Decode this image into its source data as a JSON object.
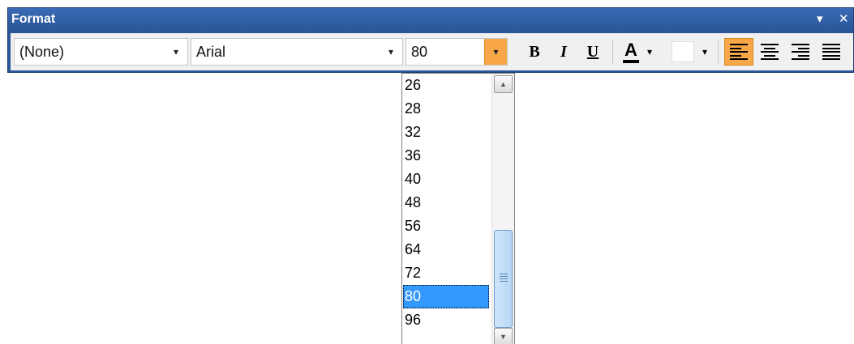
{
  "panel": {
    "title": "Format",
    "menu_glyph": "▾",
    "close_glyph": "✕"
  },
  "toolbar": {
    "style_select": {
      "value": "(None)",
      "arrow": "▾"
    },
    "font_select": {
      "value": "Arial",
      "arrow": "▾"
    },
    "size_select": {
      "value": "80",
      "arrow": "▾"
    },
    "bold_label": "B",
    "italic_label": "I",
    "underline_label": "U",
    "font_color_label": "A",
    "font_color_arrow": "▾",
    "fill_color_arrow": "▾",
    "accent_active": "#f7a747"
  },
  "size_dropdown": {
    "items": [
      "26",
      "28",
      "32",
      "36",
      "40",
      "48",
      "56",
      "64",
      "72",
      "80",
      "96"
    ],
    "selected": "80",
    "scroll_up": "▲",
    "scroll_down": "▼"
  },
  "icons": {
    "align_left": "align-left-icon",
    "align_center": "align-center-icon",
    "align_right": "align-right-icon",
    "justify": "justify-icon"
  }
}
